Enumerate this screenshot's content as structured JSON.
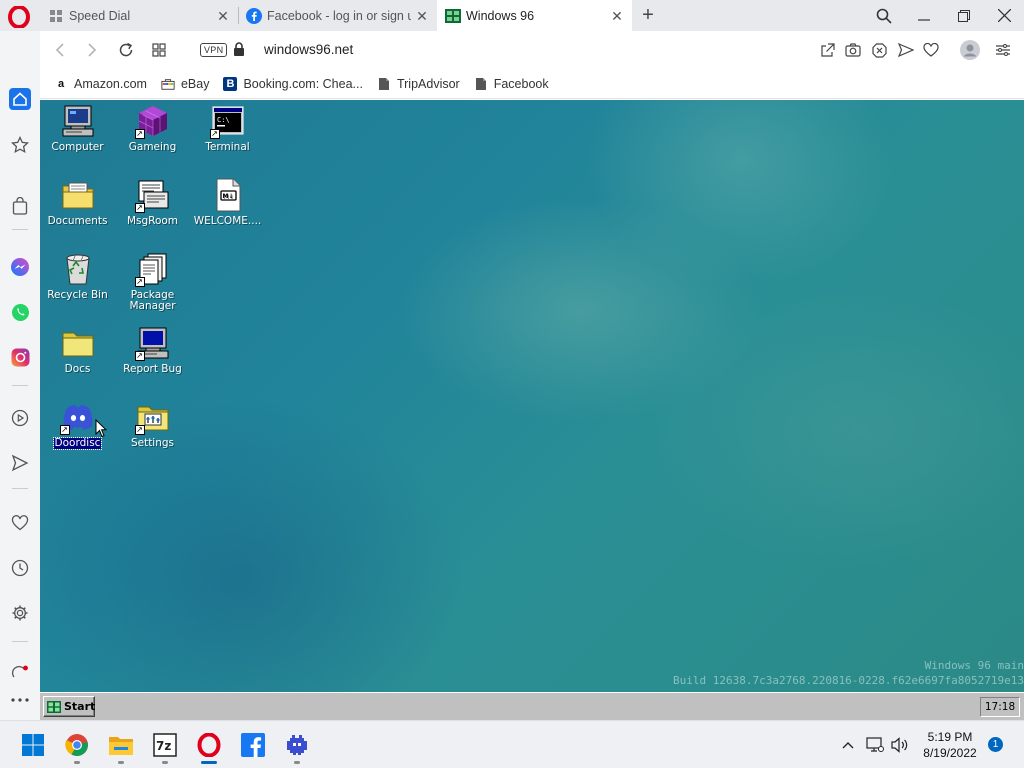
{
  "tabs": [
    {
      "title": "Speed Dial",
      "icon": "speed-dial-icon"
    },
    {
      "title": "Facebook - log in or sign u",
      "icon": "facebook-icon"
    },
    {
      "title": "Windows 96",
      "icon": "windows96-icon"
    }
  ],
  "address": {
    "vpn": "VPN",
    "url": "windows96.net"
  },
  "bookmarks": [
    {
      "label": "Amazon.com",
      "icon": "amazon-icon"
    },
    {
      "label": "eBay",
      "icon": "ebay-icon"
    },
    {
      "label": "Booking.com: Chea...",
      "icon": "booking-icon"
    },
    {
      "label": "TripAdvisor",
      "icon": "tripadvisor-icon"
    },
    {
      "label": "Facebook",
      "icon": "facebook-icon"
    }
  ],
  "desktop": {
    "icons": [
      {
        "label": "Computer",
        "icon": "computer-icon"
      },
      {
        "label": "Gameing",
        "icon": "cube-icon"
      },
      {
        "label": "Terminal",
        "icon": "terminal-icon"
      },
      {
        "label": "Documents",
        "icon": "documents-folder-icon"
      },
      {
        "label": "MsgRoom",
        "icon": "msgroom-icon"
      },
      {
        "label": "WELCOME....",
        "icon": "markdown-file-icon"
      },
      {
        "label": "Recycle Bin",
        "icon": "recycle-bin-icon"
      },
      {
        "label": "Package Manager",
        "icon": "package-manager-icon"
      },
      {
        "label": "Docs",
        "icon": "folder-icon"
      },
      {
        "label": "Report Bug",
        "icon": "report-bug-icon"
      },
      {
        "label": "Doordisc",
        "icon": "discord-icon",
        "selected": true
      },
      {
        "label": "Settings",
        "icon": "settings-folder-icon"
      }
    ],
    "build_line1": "Windows 96 main",
    "build_line2": "Build 12638.7c3a2768.220816-0228.f62e6697fa8052719e13"
  },
  "w96_taskbar": {
    "start": "Start",
    "clock": "17:18"
  },
  "win_taskbar": {
    "time": "5:19 PM",
    "date": "8/19/2022",
    "notifications": "1"
  }
}
